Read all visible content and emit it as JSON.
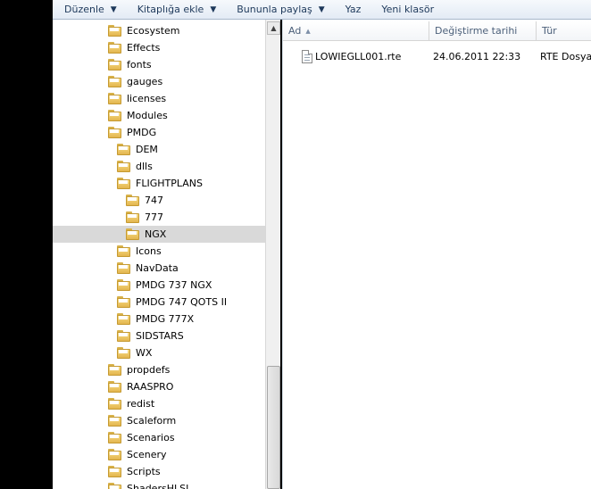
{
  "toolbar": {
    "items": [
      {
        "label": "Düzenle",
        "dropdown": true
      },
      {
        "label": "Kitaplığa ekle",
        "dropdown": true
      },
      {
        "label": "Bununla paylaş",
        "dropdown": true
      },
      {
        "label": "Yaz",
        "dropdown": false
      },
      {
        "label": "Yeni klasör",
        "dropdown": false
      }
    ]
  },
  "tree": {
    "items": [
      {
        "label": "Ecosystem",
        "level": 0
      },
      {
        "label": "Effects",
        "level": 0
      },
      {
        "label": "fonts",
        "level": 0
      },
      {
        "label": "gauges",
        "level": 0
      },
      {
        "label": "licenses",
        "level": 0
      },
      {
        "label": "Modules",
        "level": 0
      },
      {
        "label": "PMDG",
        "level": 0
      },
      {
        "label": "DEM",
        "level": 1
      },
      {
        "label": "dlls",
        "level": 1
      },
      {
        "label": "FLIGHTPLANS",
        "level": 1
      },
      {
        "label": "747",
        "level": 2
      },
      {
        "label": "777",
        "level": 2
      },
      {
        "label": "NGX",
        "level": 2,
        "selected": true
      },
      {
        "label": "Icons",
        "level": 1
      },
      {
        "label": "NavData",
        "level": 1
      },
      {
        "label": "PMDG 737 NGX",
        "level": 1
      },
      {
        "label": "PMDG 747 QOTS II",
        "level": 1
      },
      {
        "label": "PMDG 777X",
        "level": 1
      },
      {
        "label": "SIDSTARS",
        "level": 1
      },
      {
        "label": "WX",
        "level": 1
      },
      {
        "label": "propdefs",
        "level": 0
      },
      {
        "label": "RAASPRO",
        "level": 0
      },
      {
        "label": "redist",
        "level": 0
      },
      {
        "label": "Scaleform",
        "level": 0
      },
      {
        "label": "Scenarios",
        "level": 0
      },
      {
        "label": "Scenery",
        "level": 0
      },
      {
        "label": "Scripts",
        "level": 0
      },
      {
        "label": "ShadersHLSL",
        "level": 0
      }
    ]
  },
  "files": {
    "columns": [
      "Ad",
      "Değiştirme tarihi",
      "Tür"
    ],
    "rows": [
      {
        "name": "LOWIEGLL001.rte",
        "modified": "24.06.2011 22:33",
        "type": "RTE Dosyası"
      }
    ]
  }
}
